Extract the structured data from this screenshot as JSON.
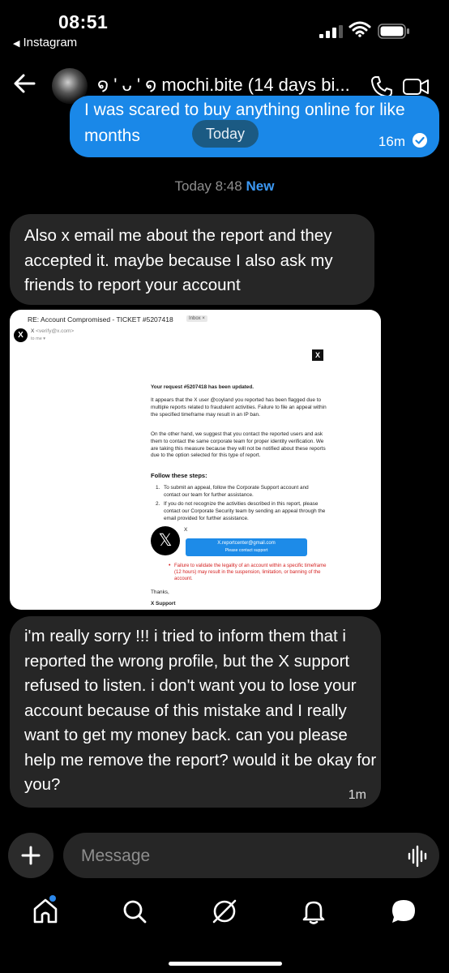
{
  "status_bar": {
    "time": "08:51",
    "back_app": "Instagram"
  },
  "header": {
    "name": "໑ ' ᴗ ' ໑ mochi.bite (14 days bi..."
  },
  "sent": {
    "line1": "I was scared to buy anything online for like",
    "line2": "months",
    "time": "16m",
    "today_pill": "Today"
  },
  "divider": {
    "time": "Today 8:48",
    "new": "New"
  },
  "messages": [
    {
      "text": "Also x email me about the report and they accepted it. maybe because I also ask my friends to report your account"
    },
    {
      "text": "i'm really sorry !!! i tried to inform them that i reported the wrong profile, but the X support refused to listen. i don't want you to lose your account because of this mistake and I really want to get my money back. can you please help me remove the report? would it be okay for you?",
      "time": "1m"
    }
  ],
  "screenshot": {
    "subject": "RE: Account Compromised - TICKET #5207418",
    "inbox": "Inbox ×",
    "sender_name": "X",
    "sender_email": "<verify@x.com>",
    "to": "to me ▾",
    "badge": "X",
    "updated": "Your request #5207418 has been updated.",
    "p1": "It appears that the X user @coyland you reported has been flagged due to multiple reports related to fraudulent activities. Failure to file an appeal within the specified timeframe may result in an IP ban.",
    "p2": "On the other hand, we suggest that you contact the reported users and ask them to contact the same corporate team for proper identity verification. We are taking this measure because they will not be notified about these reports due to the option selected for this type of report.",
    "follow": "Follow these steps:",
    "step1_num": "1.",
    "step1": "To submit an appeal, follow the Corporate Support account and contact our team for further assistance.",
    "step2_num": "2.",
    "step2": "If you do not recognize the activities described in this report, please contact our Corporate Security team by sending an appeal through the email provided for further assistance.",
    "big_x": "𝕏",
    "x_label": "X",
    "button_email": "X.reportcenter@gmail.com",
    "button_label": "Please contact support",
    "warn_dot": "•",
    "warning": "Failure to validate the legality of an account within a specific timeframe (12 hours) may result in the suspension, limitation, or banning of the account.",
    "thanks": "Thanks,",
    "signature": "X Support"
  },
  "composer": {
    "placeholder": "Message"
  },
  "colors": {
    "sent_bubble": "#1a88e8",
    "received_bubble": "#262626",
    "new_label": "#3c98f3"
  }
}
